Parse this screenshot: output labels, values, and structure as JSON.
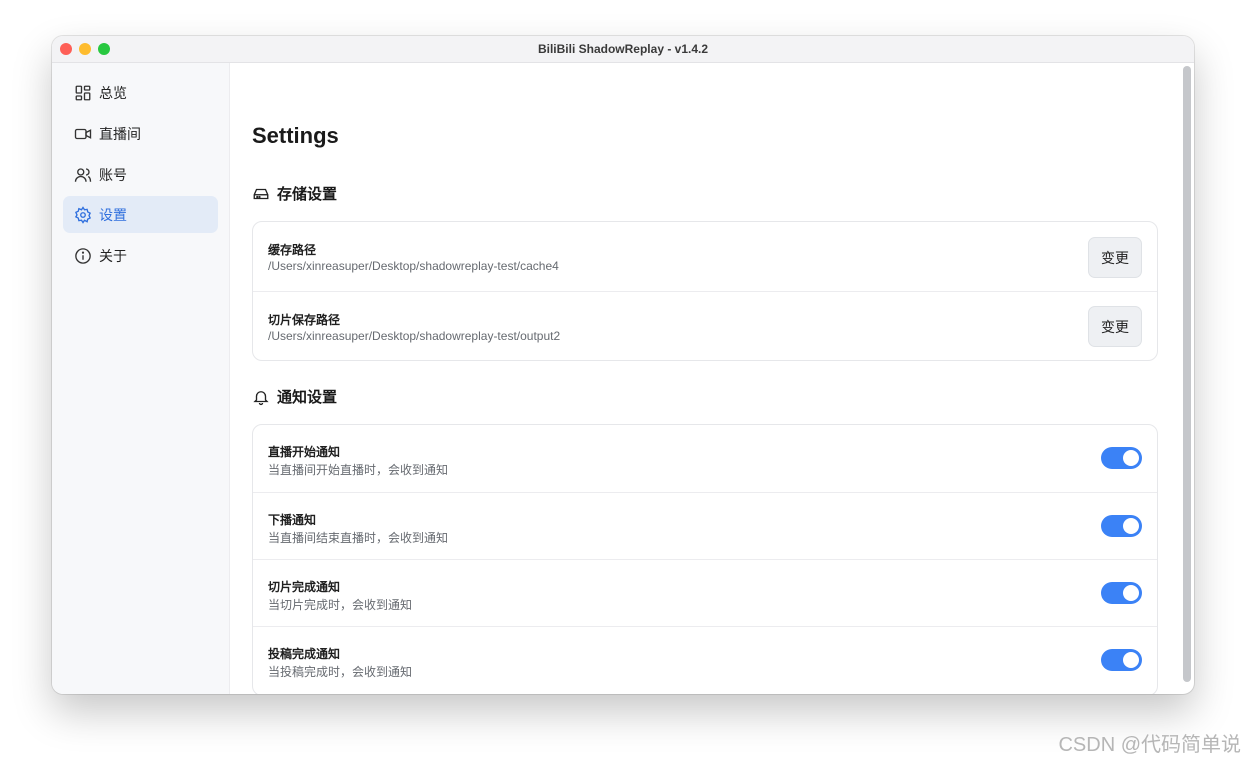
{
  "window": {
    "title": "BiliBili ShadowReplay - v1.4.2"
  },
  "sidebar": {
    "items": [
      {
        "label": "总览",
        "icon": "grid-icon",
        "active": false
      },
      {
        "label": "直播间",
        "icon": "video-icon",
        "active": false
      },
      {
        "label": "账号",
        "icon": "users-icon",
        "active": false
      },
      {
        "label": "设置",
        "icon": "gear-icon",
        "active": true
      },
      {
        "label": "关于",
        "icon": "info-icon",
        "active": false
      }
    ]
  },
  "main": {
    "page_title": "Settings",
    "storage": {
      "section_title": "存储设置",
      "icon": "hard-drive-icon",
      "rows": [
        {
          "title": "缓存路径",
          "value": "/Users/xinreasuper/Desktop/shadowreplay-test/cache4",
          "button_label": "变更"
        },
        {
          "title": "切片保存路径",
          "value": "/Users/xinreasuper/Desktop/shadowreplay-test/output2",
          "button_label": "变更"
        }
      ]
    },
    "notifications": {
      "section_title": "通知设置",
      "icon": "bell-icon",
      "rows": [
        {
          "title": "直播开始通知",
          "description": "当直播间开始直播时，会收到通知",
          "enabled": true
        },
        {
          "title": "下播通知",
          "description": "当直播间结束直播时，会收到通知",
          "enabled": true
        },
        {
          "title": "切片完成通知",
          "description": "当切片完成时，会收到通知",
          "enabled": true
        },
        {
          "title": "投稿完成通知",
          "description": "当投稿完成时，会收到通知",
          "enabled": true
        }
      ]
    }
  },
  "watermark": "CSDN @代码简单说",
  "colors": {
    "accent": "#3b82f6",
    "active_nav_bg": "#e3ebf7",
    "active_nav_text": "#2f6fde"
  }
}
